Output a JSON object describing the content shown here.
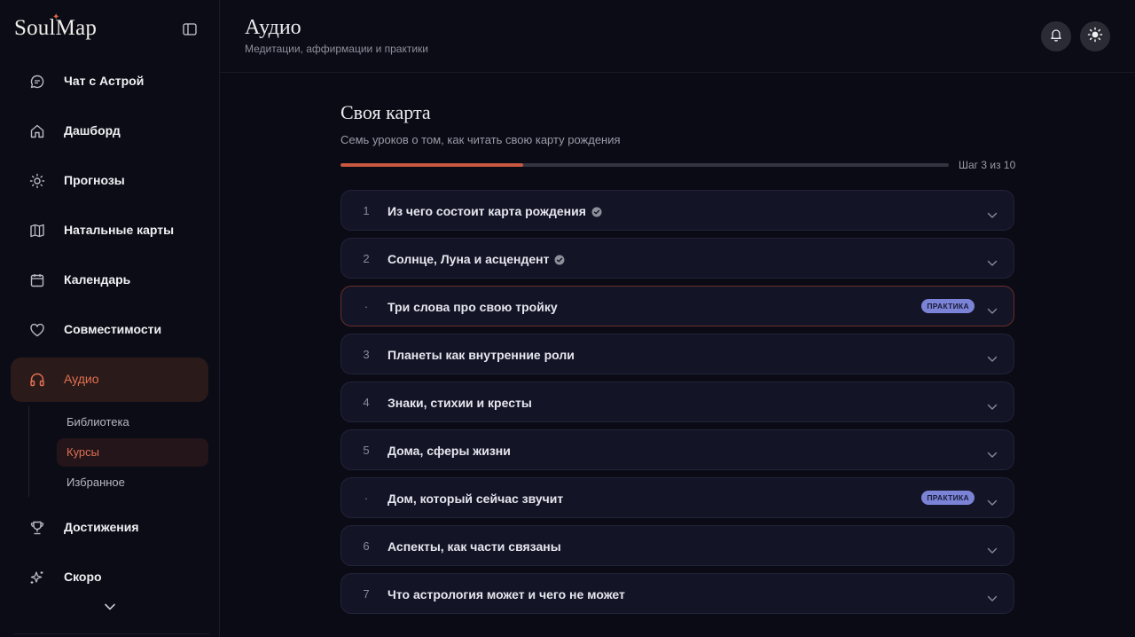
{
  "app": {
    "logo": "SoulMap"
  },
  "sidebar": {
    "items": [
      {
        "label": "Чат с Астрой",
        "icon": "chat-bubble-icon"
      },
      {
        "label": "Дашборд",
        "icon": "home-icon"
      },
      {
        "label": "Прогнозы",
        "icon": "sun-icon"
      },
      {
        "label": "Натальные карты",
        "icon": "map-icon"
      },
      {
        "label": "Календарь",
        "icon": "calendar-icon"
      },
      {
        "label": "Совместимости",
        "icon": "heart-icon"
      },
      {
        "label": "Аудио",
        "icon": "headphones-icon",
        "active": true
      },
      {
        "label": "Достижения",
        "icon": "trophy-icon"
      },
      {
        "label": "Скоро",
        "icon": "sparkles-icon"
      }
    ],
    "subitems": [
      {
        "label": "Библиотека"
      },
      {
        "label": "Курсы",
        "active": true
      },
      {
        "label": "Избранное"
      }
    ]
  },
  "header": {
    "title": "Аудио",
    "subtitle": "Медитации, аффирмации и практики"
  },
  "course": {
    "title": "Своя карта",
    "description": "Семь уроков о том, как читать свою карту рождения",
    "progress_label": "Шаг 3 из 10",
    "progress": 0.3,
    "lessons": [
      {
        "num": "1",
        "title": "Из чего состоит карта рождения",
        "done": true
      },
      {
        "num": "2",
        "title": "Солнце, Луна и асцендент",
        "done": true
      },
      {
        "num": "·",
        "title": "Три слова про свою тройку",
        "badge": "ПРАКТИКА",
        "current": true
      },
      {
        "num": "3",
        "title": "Планеты как внутренние роли"
      },
      {
        "num": "4",
        "title": "Знаки, стихии и кресты"
      },
      {
        "num": "5",
        "title": "Дома, сферы жизни"
      },
      {
        "num": "·",
        "title": "Дом, который сейчас звучит",
        "badge": "ПРАКТИКА"
      },
      {
        "num": "6",
        "title": "Аспекты, как части связаны"
      },
      {
        "num": "7",
        "title": "Что астрология может и чего не может"
      }
    ]
  },
  "colors": {
    "accent": "#e0704f",
    "progress": "#c8583f",
    "badge": "#7b83d6",
    "background": "#0a0b14",
    "card": "#131426"
  }
}
